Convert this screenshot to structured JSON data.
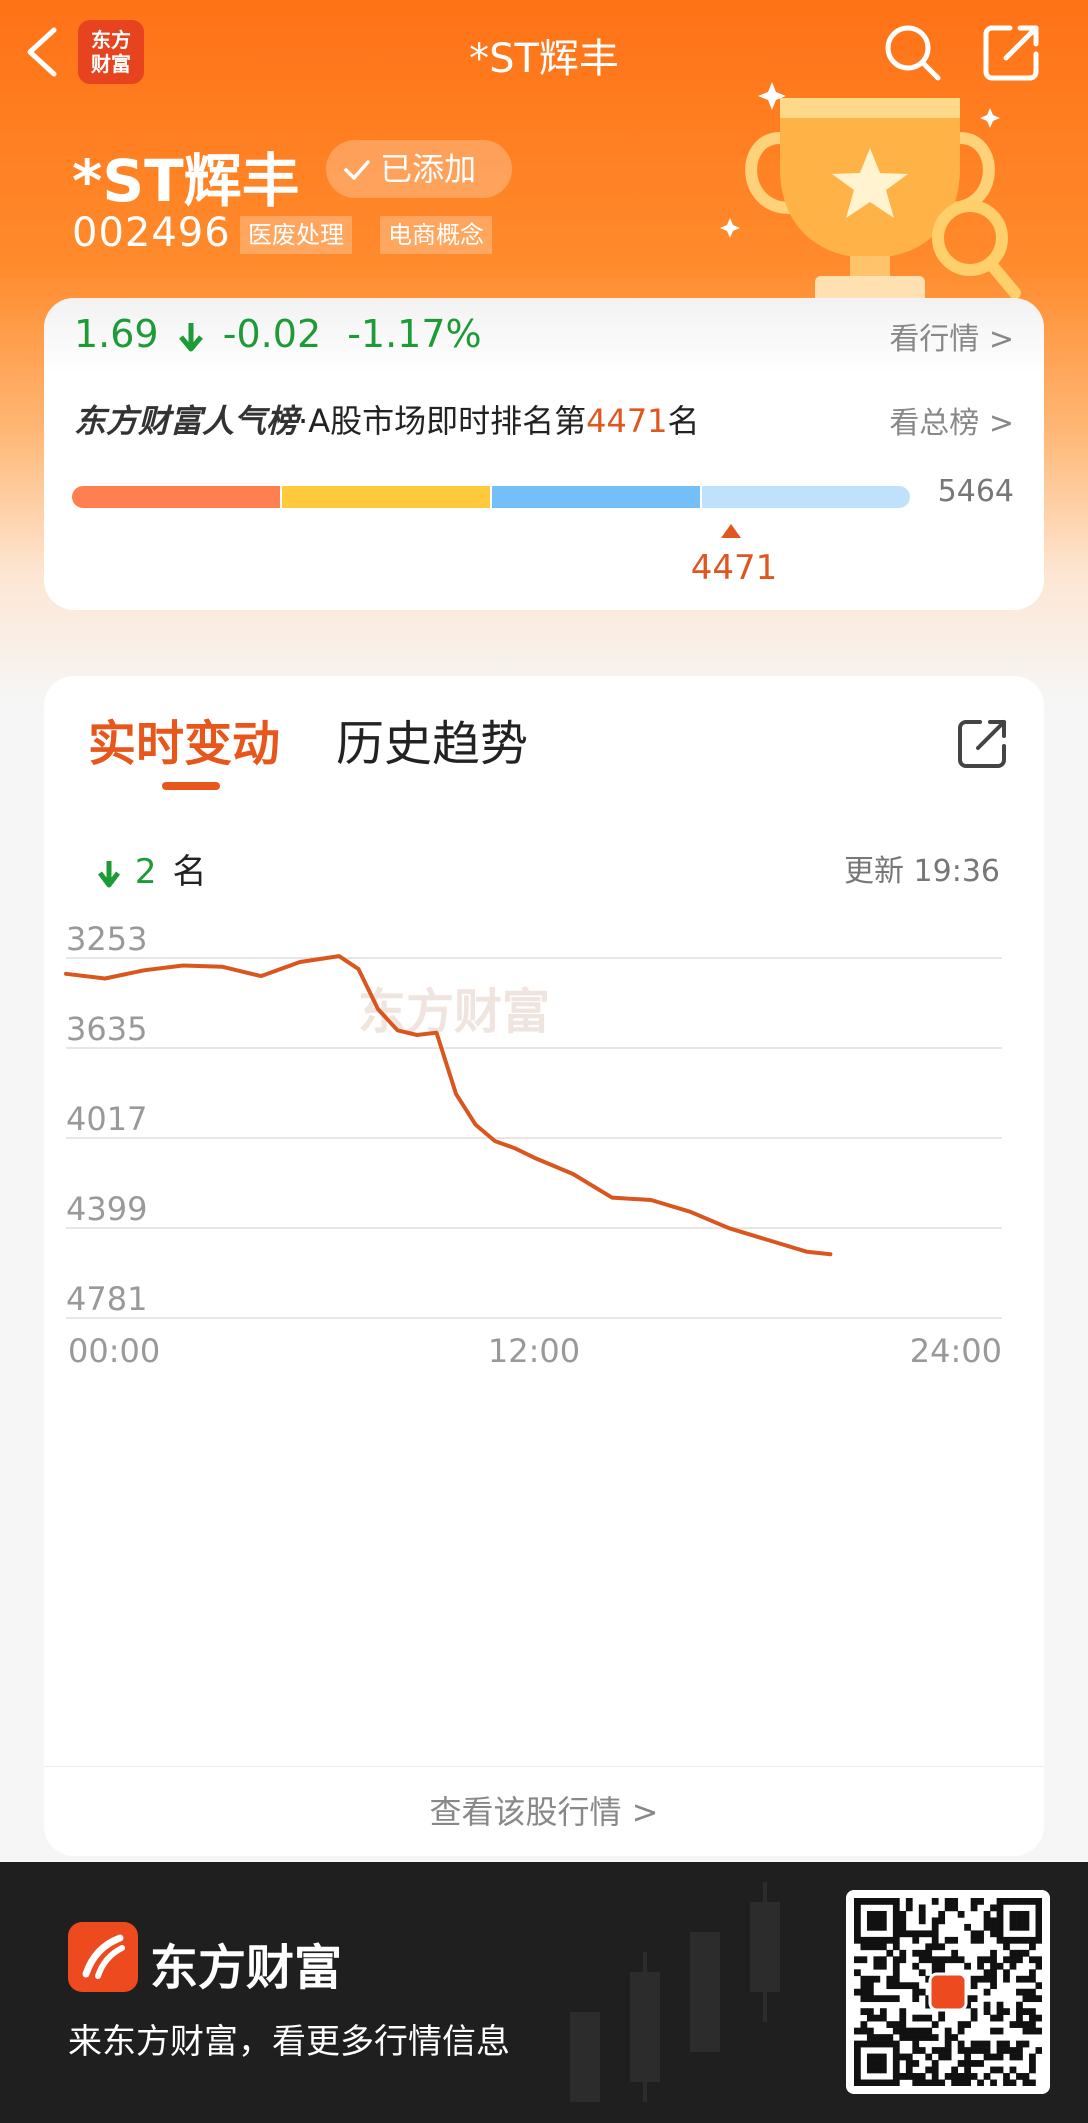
{
  "nav": {
    "title": "*ST辉丰",
    "logo_text": [
      "东方",
      "财富"
    ]
  },
  "stock": {
    "name": "*ST辉丰",
    "added_label": "已添加",
    "code": "002496",
    "tags": [
      "医废处理",
      "电商概念"
    ]
  },
  "quote": {
    "price": "1.69",
    "change": "-0.02",
    "change_pct": "-1.17%",
    "see_quote": "看行情 >"
  },
  "popularity": {
    "brand": "东方财富人气榜",
    "text_prefix": "·A股市场即时排名第",
    "rank": "4471",
    "text_suffix": "名",
    "see_all": "看总榜 >",
    "total": "5464",
    "marker_value": "4471",
    "segment_colors": [
      "#ff7f50",
      "#ffc93c",
      "#74bff7",
      "#bfe1fb"
    ]
  },
  "realtime": {
    "tabs": [
      "实时变动",
      "历史趋势"
    ],
    "active_tab": "实时变动",
    "change_value": "2",
    "change_unit": "名",
    "updated": "更新 19:36",
    "footer_link": "查看该股行情 >"
  },
  "chart_data": {
    "type": "line",
    "y_ticks": [
      3253,
      3635,
      4017,
      4399,
      4781
    ],
    "ylim": [
      3253,
      4781
    ],
    "y_inverted": true,
    "x_ticks": [
      "00:00",
      "12:00",
      "24:00"
    ],
    "xlim_hours": [
      0,
      24
    ],
    "watermark": "东方财富",
    "line_color": "#d9561f",
    "series": [
      {
        "x": [
          0,
          1,
          2,
          3,
          4,
          5,
          6,
          7,
          7.5,
          8,
          8.5,
          9,
          9.5,
          10,
          10.5,
          11,
          11.5,
          12,
          13,
          14,
          15,
          16,
          17,
          18,
          19,
          19.6
        ],
        "values": [
          3320,
          3340,
          3305,
          3285,
          3290,
          3330,
          3270,
          3245,
          3300,
          3470,
          3560,
          3580,
          3570,
          3830,
          3960,
          4030,
          4060,
          4100,
          4170,
          4270,
          4280,
          4330,
          4400,
          4450,
          4500,
          4510
        ]
      }
    ]
  },
  "bottom_bar": {
    "brand": "东方财富",
    "slogan": "来东方财富，看更多行情信息"
  }
}
